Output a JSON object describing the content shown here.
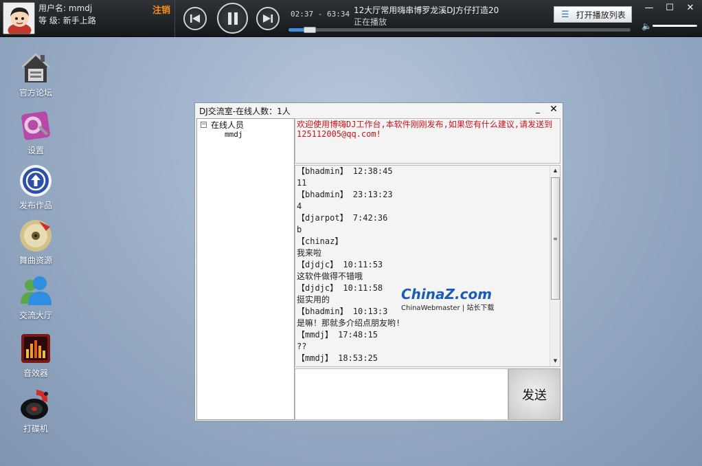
{
  "user": {
    "name_label": "用户名:",
    "name": "mmdj",
    "level_label": "等  级:",
    "level": "新手上路",
    "logout": "注销"
  },
  "player": {
    "time": "02:37 - 63:34",
    "song_title": "12大厅常用嗨串博罗龙溪DJ方仔打造20",
    "status": "正在播放",
    "playlist_button": "打开播放列表",
    "progress_fraction": 0.041,
    "volume": 0.95
  },
  "window_buttons": {
    "minimize": "—",
    "maximize": "☐",
    "close": "✕"
  },
  "desktop_icons": [
    {
      "label": "官方论坛",
      "icon": "forum-house-icon"
    },
    {
      "label": "设置",
      "icon": "settings-icon"
    },
    {
      "label": "发布作品",
      "icon": "upload-icon"
    },
    {
      "label": "舞曲资源",
      "icon": "music-disc-icon"
    },
    {
      "label": "交流大厅",
      "icon": "users-icon"
    },
    {
      "label": "音效器",
      "icon": "equalizer-icon"
    },
    {
      "label": "打碟机",
      "icon": "turntable-icon"
    }
  ],
  "chat": {
    "title": "DJ交流室-在线人数：1人",
    "min": "_",
    "close": "✕",
    "tree_toggle": "−",
    "tree_root": "在线人员",
    "tree_members": [
      "mmdj"
    ],
    "notice": "欢迎使用博嗨DJ工作台,本软件刚刚发布,如果您有什么建议,请发送到125112005@qq.com!",
    "messages": [
      "【bhadmin】 12:38:45",
      "11",
      "【bhadmin】 23:13:23",
      "4",
      "【djarpot】 7:42:36",
      "b",
      "【chinaz】",
      "我来啦",
      "【djdjc】 10:11:53",
      "这软件做得不错哦",
      "【djdjc】 10:11:58",
      "挺实用的",
      "【bhadmin】 10:13:3",
      "是嘛！那就多介绍点朋友哟!",
      "【mmdj】 17:48:15",
      "??",
      "【mmdj】 18:53:25"
    ],
    "send_button": "发送",
    "scroll_up": "▲",
    "scroll_down": "▼",
    "scroll_grip": "≡"
  },
  "watermark": {
    "logo": "ChinaZ.com",
    "sub": "ChinaWebmaster | 站长下载"
  }
}
